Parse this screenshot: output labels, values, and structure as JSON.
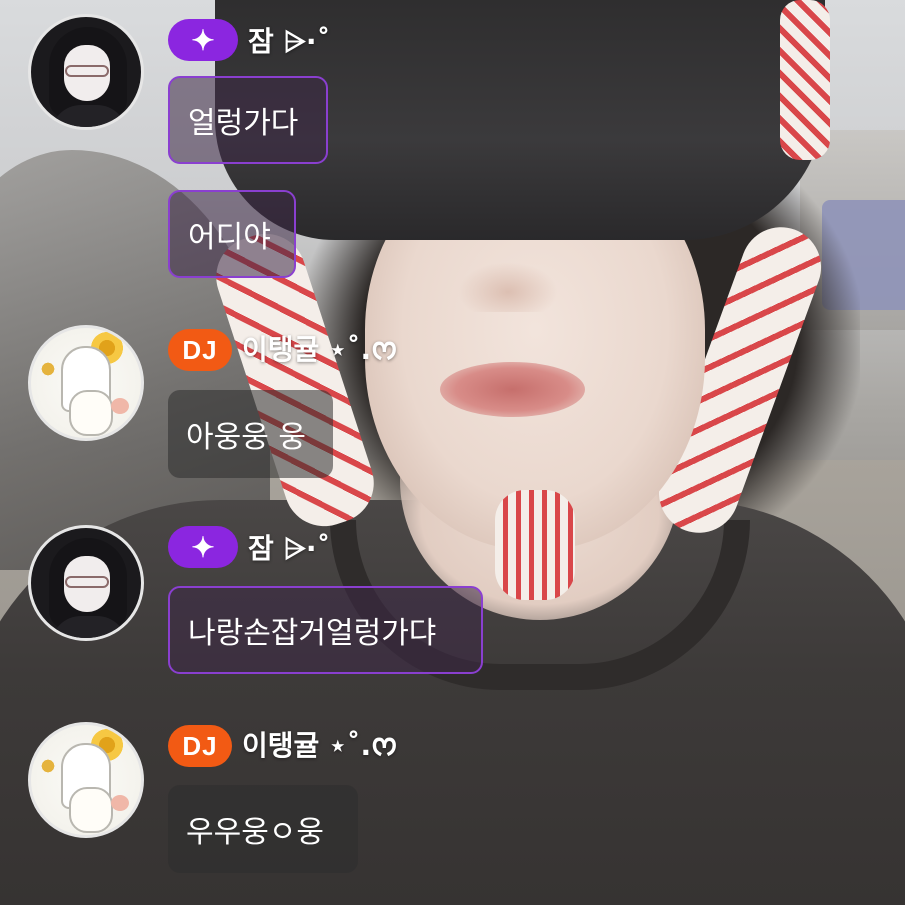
{
  "messages": [
    {
      "user": {
        "name": "잠 ⩥·˚",
        "badge": "✦",
        "badge_type": "sparkle",
        "avatar": "anime-girl-avatar"
      },
      "bubbles": [
        "얼렁가다",
        "어디야"
      ]
    },
    {
      "user": {
        "name": "이탱귤 ⋆˚.ᰔ",
        "badge": "DJ",
        "badge_type": "dj",
        "avatar": "sketch-avatar"
      },
      "bubbles": [
        "아웅웅 웅"
      ]
    },
    {
      "user": {
        "name": "잠 ⩥·˚",
        "badge": "✦",
        "badge_type": "sparkle",
        "avatar": "anime-girl-avatar"
      },
      "bubbles": [
        "나랑손잡거얼렁가댜"
      ]
    },
    {
      "user": {
        "name": "이탱귤 ⋆˚.ᰔ",
        "badge": "DJ",
        "badge_type": "dj",
        "avatar": "sketch-avatar"
      },
      "bubbles": [
        "우우웅ㅇ웅"
      ]
    }
  ],
  "colors": {
    "sparkle_badge": "#8b26e0",
    "dj_badge": "#f25a14",
    "highlight_border": "#8a3fd0",
    "text": "#ffffff"
  }
}
